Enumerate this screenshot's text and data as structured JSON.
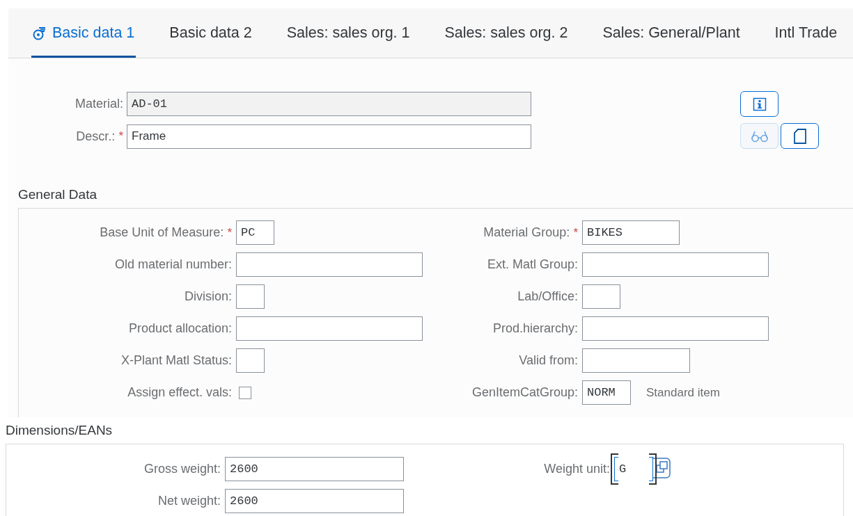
{
  "tabs": [
    {
      "label": "Basic data 1",
      "selected": true,
      "icon": true
    },
    {
      "label": "Basic data 2",
      "selected": false,
      "icon": false
    },
    {
      "label": "Sales: sales org. 1",
      "selected": false,
      "icon": false
    },
    {
      "label": "Sales: sales org. 2",
      "selected": false,
      "icon": false
    },
    {
      "label": "Sales: General/Plant",
      "selected": false,
      "icon": false
    },
    {
      "label": "Intl Trade",
      "selected": false,
      "icon": false
    }
  ],
  "header": {
    "fields": [
      {
        "label": "Material:",
        "value": "AD-01",
        "readonly": true,
        "kind": "code"
      },
      {
        "label": "Descr.:",
        "required_mark": "*",
        "value": "Frame",
        "readonly": false,
        "kind": "text"
      }
    ],
    "buttons": [
      {
        "kind": "info",
        "disabled": false
      },
      {
        "kind": "display",
        "disabled": true
      },
      {
        "kind": "document",
        "disabled": false
      }
    ]
  },
  "general_data": {
    "title": "General Data",
    "left": [
      {
        "kind": "input",
        "label": "Base Unit of Measure:",
        "required_mark": "*",
        "value": "PC"
      },
      {
        "kind": "input",
        "label": "Old material number:"
      },
      {
        "kind": "input",
        "label": "Division:"
      },
      {
        "kind": "input",
        "label": "Product allocation:"
      },
      {
        "kind": "input",
        "label": "X-Plant Matl Status:"
      },
      {
        "kind": "checkbox",
        "label": "Assign effect. vals:",
        "checked": false
      }
    ],
    "right": [
      {
        "kind": "input",
        "label": "Material Group:",
        "required_mark": "*",
        "value": "BIKES"
      },
      {
        "kind": "input",
        "label": "Ext. Matl Group:"
      },
      {
        "kind": "input",
        "label": "Lab/Office:"
      },
      {
        "kind": "input",
        "label": "Prod.hierarchy:"
      },
      {
        "kind": "input",
        "label": "Valid from:"
      },
      {
        "kind": "input",
        "label": "GenItemCatGroup:",
        "value": "NORM",
        "description": "Standard item"
      }
    ]
  },
  "dimensions": {
    "title": "Dimensions/EANs",
    "left": [
      {
        "kind": "input",
        "label": "Gross weight:",
        "value": "2600",
        "focused": false
      },
      {
        "kind": "input",
        "label": "Net weight:",
        "value": "2600",
        "focused": false
      }
    ],
    "right": [
      {
        "kind": "input",
        "label": "Weight unit:",
        "value": "G",
        "focused": true,
        "value_help": true
      }
    ]
  }
}
